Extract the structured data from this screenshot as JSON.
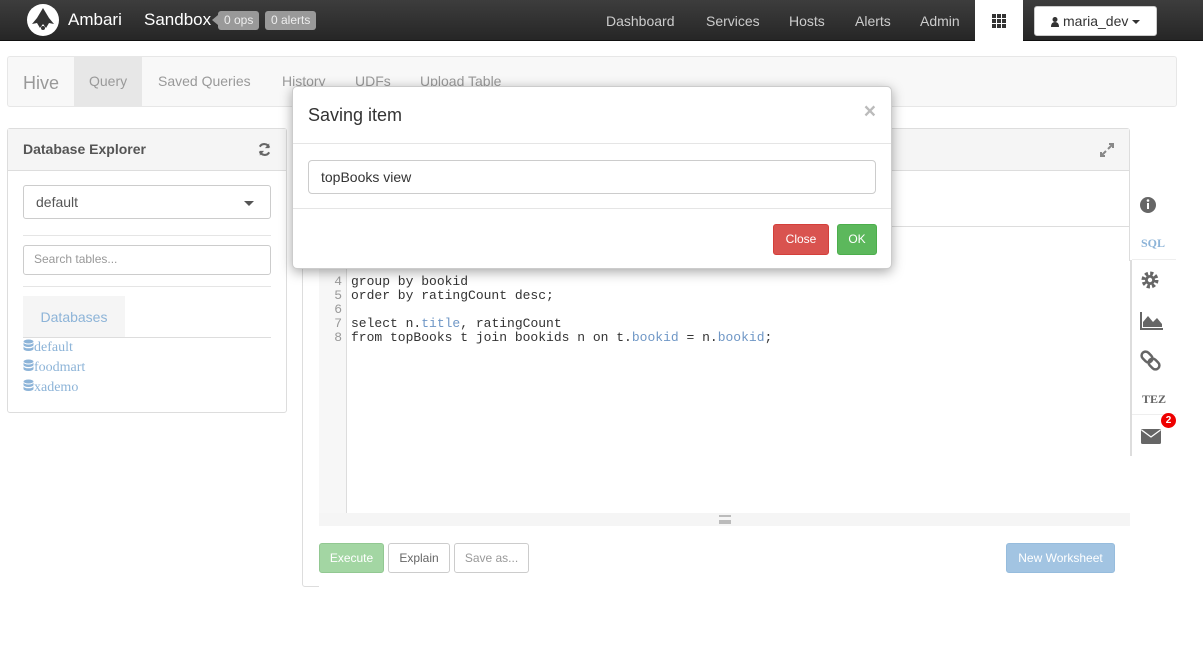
{
  "topbar": {
    "brand": "Ambari",
    "cluster": "Sandbox",
    "ops_badge": "0 ops",
    "alerts_badge": "0 alerts",
    "nav": [
      "Dashboard",
      "Services",
      "Hosts",
      "Alerts",
      "Admin"
    ],
    "user": "maria_dev"
  },
  "hive": {
    "title": "Hive",
    "tabs": [
      "Query",
      "Saved Queries",
      "History",
      "UDFs",
      "Upload Table"
    ],
    "active_tab": "Query"
  },
  "db_explorer": {
    "title": "Database Explorer",
    "selected_db": "default",
    "search_placeholder": "Search tables...",
    "tab_label": "Databases",
    "databases": [
      "default",
      "foodmart",
      "xademo"
    ]
  },
  "editor": {
    "lines": [
      {
        "num": "4",
        "text": "group by bookid"
      },
      {
        "num": "5",
        "text": "order by ratingCount desc;"
      },
      {
        "num": "6",
        "text": ""
      },
      {
        "num": "7",
        "pre": "select n.",
        "kw": "title",
        "post": ", ratingCount"
      },
      {
        "num": "8",
        "pre": "from topBooks t join bookids n on t.",
        "kw": "bookid",
        "mid": " = n.",
        "kw2": "bookid",
        "post": ";"
      }
    ],
    "buttons": {
      "execute": "Execute",
      "explain": "Explain",
      "save_as": "Save as...",
      "new_worksheet": "New Worksheet"
    }
  },
  "sidebar": {
    "sql_label": "SQL",
    "tez_label": "TEZ",
    "notification_count": "2"
  },
  "modal": {
    "title": "Saving item",
    "close_x": "×",
    "input_value": "topBooks view",
    "close_button": "Close",
    "ok_button": "OK"
  },
  "colors": {
    "link_blue": "#8db4d8",
    "danger": "#d9534f",
    "success": "#5cb85c"
  }
}
